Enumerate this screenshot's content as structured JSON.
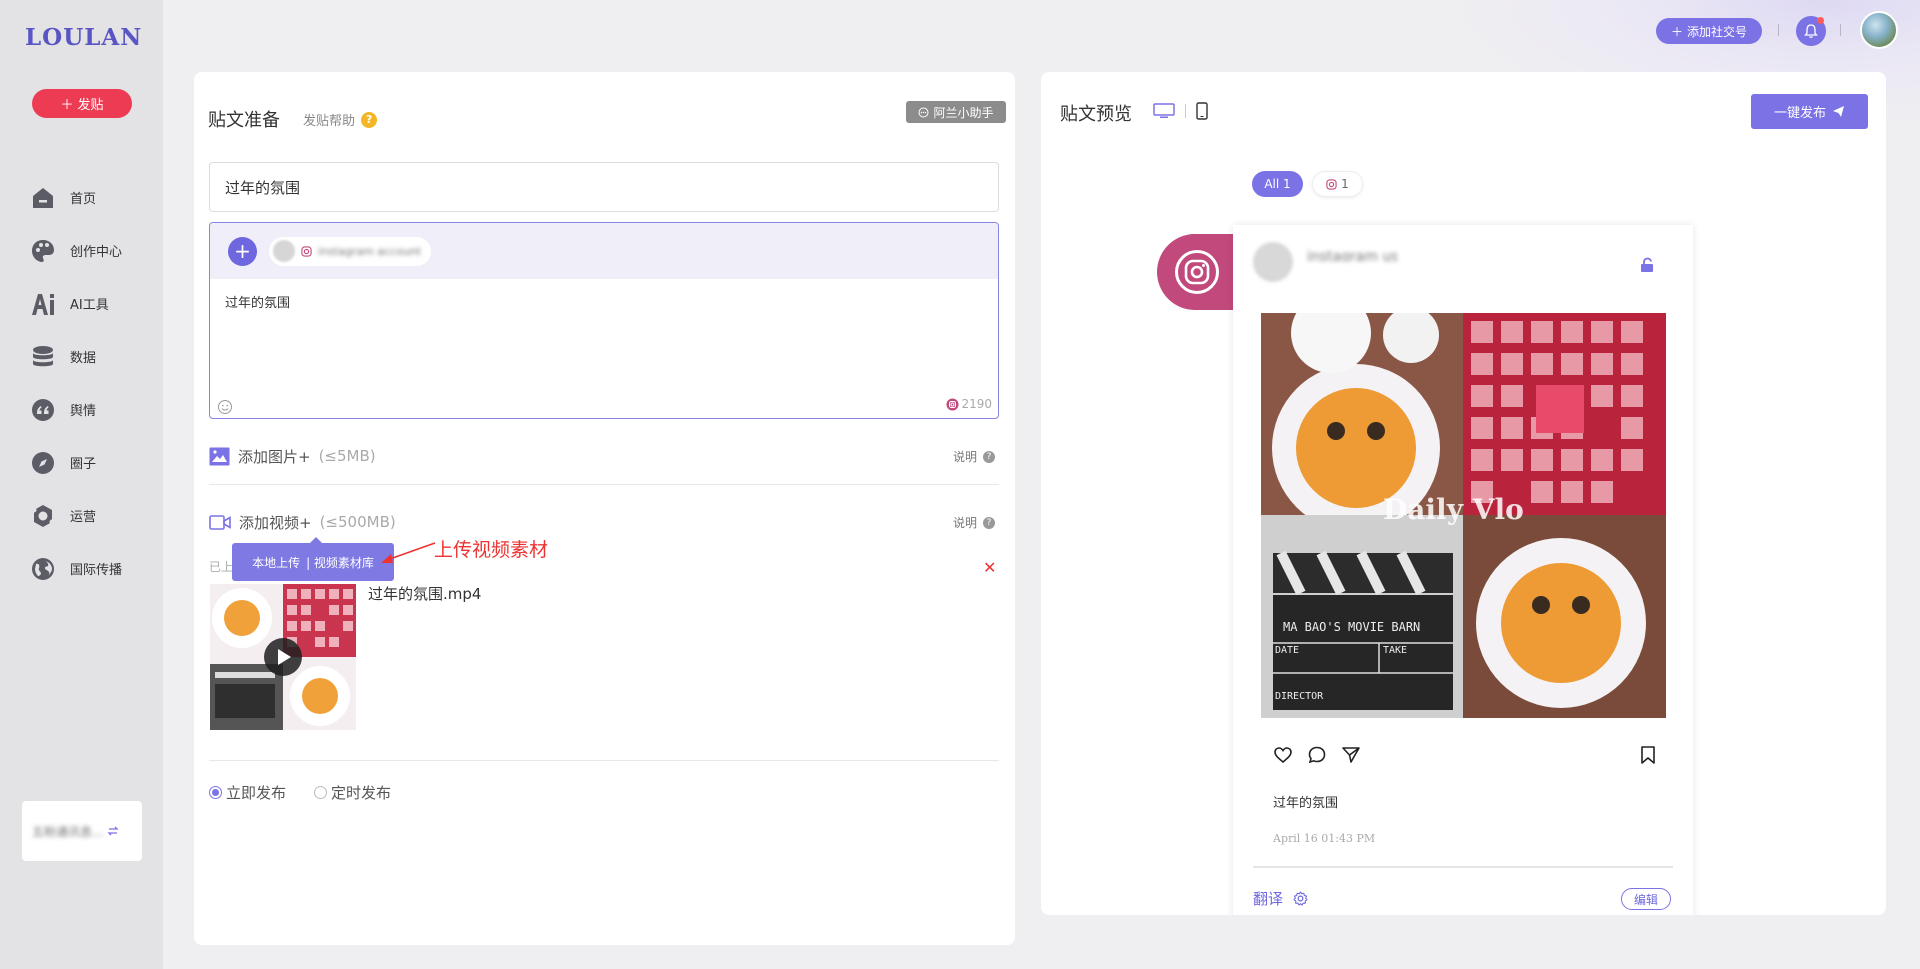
{
  "app": {
    "logo_text": "LOULAN",
    "post_button": "发贴",
    "nav": [
      {
        "label": "首页",
        "icon": "home-icon"
      },
      {
        "label": "创作中心",
        "icon": "palette-icon"
      },
      {
        "label": "AI工具",
        "icon": "ai-icon"
      },
      {
        "label": "数据",
        "icon": "database-icon"
      },
      {
        "label": "舆情",
        "icon": "quote-icon"
      },
      {
        "label": "圈子",
        "icon": "compass-icon"
      },
      {
        "label": "运营",
        "icon": "operation-icon"
      },
      {
        "label": "国际传播",
        "icon": "globe-icon"
      }
    ],
    "account_card_text": "五粉通讯息..."
  },
  "topbar": {
    "add_account_label": "添加社交号"
  },
  "editor": {
    "title": "贴文准备",
    "help_label": "发贴帮助",
    "assistant_label": "阿兰小助手",
    "title_value": "过年的氛围",
    "content_text": "过年的氛围",
    "selected_account_name": "instagram account",
    "char_count": "2190",
    "image_upload": {
      "label": "添加图片+",
      "limit": "(≤5MB)",
      "explain": "说明"
    },
    "video_upload": {
      "label": "添加视频+",
      "limit": "(≤500MB)",
      "explain": "说明"
    },
    "uploaded_label": "已上",
    "tooltip": {
      "local": "本地上传",
      "library": "| 视频素材库"
    },
    "annotation": "上传视频素材",
    "video_file_name": "过年的氛围.mp4",
    "publish_options": [
      {
        "label": "立即发布",
        "selected": true
      },
      {
        "label": "定时发布",
        "selected": false
      }
    ]
  },
  "preview": {
    "title": "贴文预览",
    "publish_all_label": "一键发布",
    "filters": [
      {
        "label": "All 1",
        "active": true
      },
      {
        "label": "1",
        "icon": "instagram-icon",
        "active": false
      }
    ],
    "post": {
      "username": "instagram user",
      "image_overlay_text": "Daily Vlo",
      "clapper_text": "MA BAO'S MOVIE BARN",
      "clapper_date": "DATE",
      "clapper_take": "TAKE",
      "clapper_director": "DIRECTOR",
      "caption": "过年的氛围",
      "date": "April 16 01:43 PM",
      "translate_label": "翻译",
      "edit_label": "编辑"
    }
  },
  "colors": {
    "accent": "#7b72e6",
    "brand_red": "#ee3b54",
    "instagram": "#c1497b"
  }
}
